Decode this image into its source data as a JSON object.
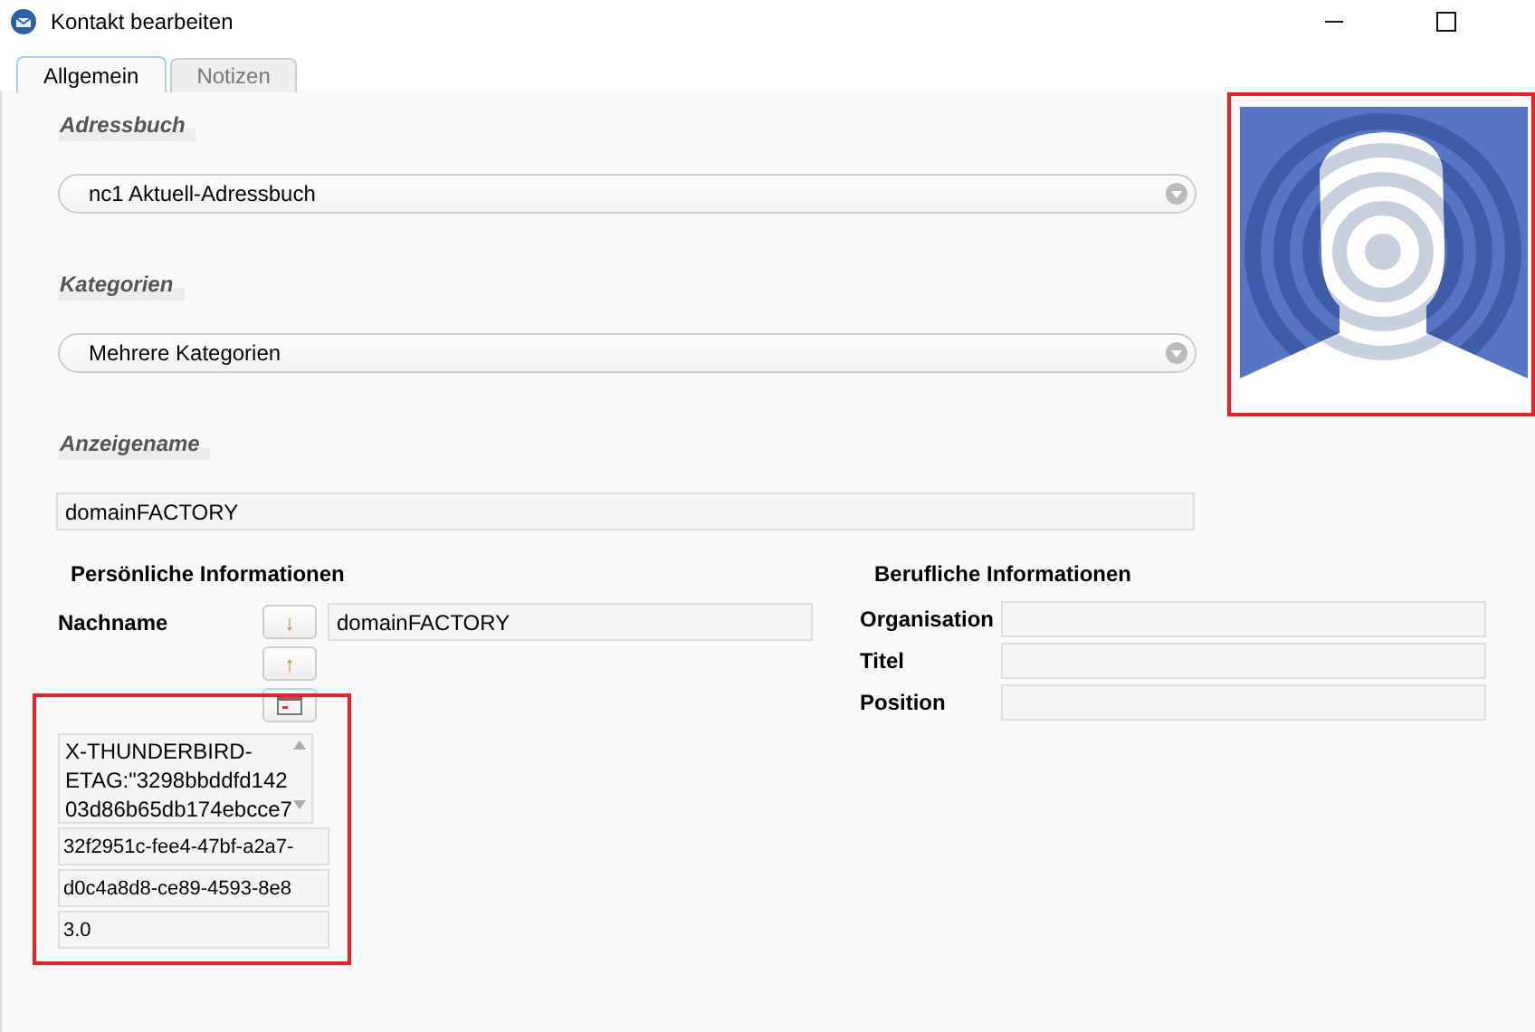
{
  "window": {
    "title": "Kontakt bearbeiten"
  },
  "tabs": [
    {
      "label": "Allgemein",
      "selected": true
    },
    {
      "label": "Notizen",
      "selected": false
    }
  ],
  "address_book": {
    "label": "Adressbuch",
    "value": "nc1 Aktuell-Adressbuch"
  },
  "categories": {
    "label": "Kategorien",
    "value": "Mehrere Kategorien"
  },
  "display_name": {
    "label": "Anzeigename",
    "value": "domainFACTORY"
  },
  "personal": {
    "heading": "Persönliche Informationen",
    "last_name": {
      "label": "Nachname",
      "value": "domainFACTORY"
    },
    "move_down": "↓",
    "move_up": "↑",
    "extra_fields": [
      {
        "kind": "textarea",
        "value": "X-THUNDERBIRD-\nETAG:\"3298bbddfd142\n03d86b65db174ebcce7"
      },
      {
        "kind": "field",
        "value": "32f2951c-fee4-47bf-a2a7-"
      },
      {
        "kind": "field",
        "value": "d0c4a8d8-ce89-4593-8e8"
      },
      {
        "kind": "field",
        "value": "3.0"
      }
    ]
  },
  "business": {
    "heading": "Berufliche Informationen",
    "fields": [
      {
        "label": "Organisation"
      },
      {
        "label": "Titel"
      },
      {
        "label": "Position"
      }
    ]
  }
}
